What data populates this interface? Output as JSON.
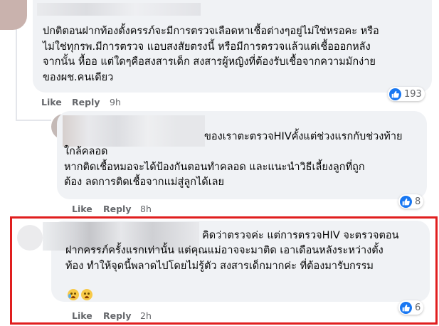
{
  "colors": {
    "bubble": "#f0f2f5",
    "like_blue": "#1877f2",
    "action_gray": "#65676b",
    "highlight_red": "#e01e1e"
  },
  "comments": [
    {
      "lines": [
        "ปกติตอนฝากท้องตั้งครรภ์จะมีการตรวจเลือดหาเชื้อต่างๆอยู่ไม่ใช่หรอคะ หรือ",
        "ไม่ใช่ทุกรพ.มีการตรวจ แอบสงสัยตรงนี้ หรือมีการตรวจแล้วแต่เชื้อออกหลัง",
        "จากนั้น หื้ออ แต่ใดๆคือสงสารเด็ก สงสารผู้หญิงที่ต้องรับเชื้อจากความมักง่าย",
        "ของผช.คนเดียว"
      ],
      "like": "Like",
      "reply": "Reply",
      "time": "9h",
      "reactions": "193"
    },
    {
      "lines": [
        "ของเราตะตรวจHIVคั้งแต่ช่วงแรกกับช่วงท้าย",
        "ใกล้คลอด",
        "หากติดเชื้อหมอจะได้ป้องกันตอนทำคลอด และแนะนำวิธีเลี้ยงลูกที่ถูก",
        "ต้อง ลดการติดเชื้อจากแม่สู่ลูกได้เลย"
      ],
      "like": "Like",
      "reply": "Reply",
      "time": "8h",
      "reactions": "8"
    },
    {
      "lines": [
        "คิดว่าตรวจค่ะ แต่การตรวจHIV จะตรวจตอน",
        "ฝากครรภ์ครั้งแรกเท่านั้น แต่คุณแม่อาจจะมาติด เอาเดือนหลังระหว่างตั้ง",
        "ท้อง ทำให้จุดนี้พลาดไปโดยไม่รู้ตัว สงสารเด็กมากค่ะ ที่ต้องมารับกรรม"
      ],
      "emoji": [
        "crying-face-icon",
        "pleading-face-icon"
      ],
      "like": "Like",
      "reply": "Reply",
      "time": "2h",
      "reactions": "6"
    }
  ]
}
